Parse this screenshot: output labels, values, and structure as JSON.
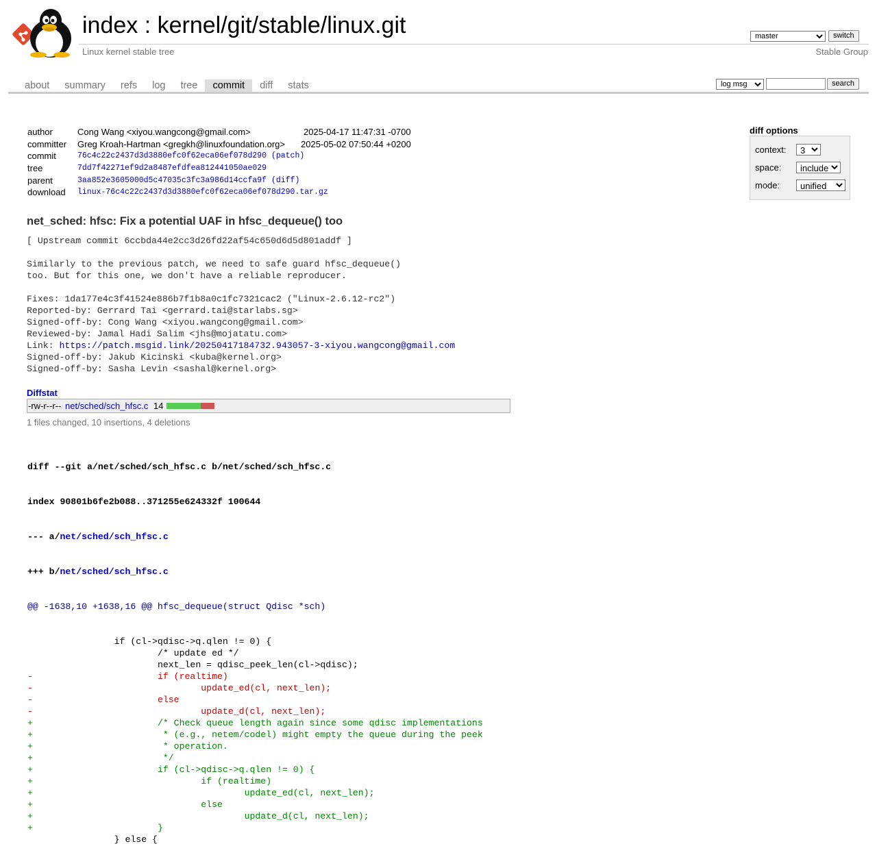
{
  "header": {
    "title_prefix": "index",
    "title_sep": " : ",
    "repo_path": "kernel/git/stable/linux.git",
    "subtitle": "Linux kernel stable tree",
    "owner": "Stable Group",
    "branch_selected": "master",
    "switch_label": "switch"
  },
  "tabs": [
    {
      "label": "about"
    },
    {
      "label": "summary"
    },
    {
      "label": "refs"
    },
    {
      "label": "log"
    },
    {
      "label": "tree"
    },
    {
      "label": "commit",
      "active": true
    },
    {
      "label": "diff"
    },
    {
      "label": "stats"
    }
  ],
  "search": {
    "type_selected": "log msg",
    "query": "",
    "button_label": "search"
  },
  "commit_info": {
    "author_label": "author",
    "author": "Cong Wang <xiyou.wangcong@gmail.com>",
    "author_date": "2025-04-17 11:47:31 -0700",
    "committer_label": "committer",
    "committer": "Greg Kroah-Hartman <gregkh@linuxfoundation.org>",
    "committer_date": "2025-05-02 07:50:44 +0200",
    "commit_label": "commit",
    "commit": "76c4c22c2437d3d3880efc0f62eca06ef078d290",
    "commit_link": "(patch)",
    "tree_label": "tree",
    "tree": "7dd7f42271ef9d2a8487efdfea812441050ae029",
    "parent_label": "parent",
    "parent": "3aa852e3605000d5c47035c3fc3a986d14ccfa9f",
    "parent_link": "(diff)",
    "download_label": "download",
    "download": "linux-76c4c22c2437d3d3880efc0f62eca06ef078d290.tar.gz"
  },
  "diff_options": {
    "title": "diff options",
    "context_label": "context:",
    "context_value": "3",
    "space_label": "space:",
    "space_value": "include",
    "mode_label": "mode:",
    "mode_value": "unified"
  },
  "message": {
    "subject": "net_sched: hfsc: Fix a potential UAF in hfsc_dequeue() too",
    "body_before_link": "[ Upstream commit 6ccbda44e2cc3d26fd22af54c650d6d5d801addf ]\n\nSimilarly to the previous patch, we need to safe guard hfsc_dequeue()\ntoo. But for this one, we don't have a reliable reproducer.\n\nFixes: 1da177e4c3f41524e886b7f1b8a0c1fc7321cac2 (\"Linux-2.6.12-rc2\")\nReported-by: Gerrard Tai <gerrard.tai@starlabs.sg>\nSigned-off-by: Cong Wang <xiyou.wangcong@gmail.com>\nReviewed-by: Jamal Hadi Salim <jhs@mojatatu.com>\n",
    "link_label": "Link: ",
    "link_url": "https://patch.msgid.link/20250417184732.943057-3-xiyou.wangcong@gmail.com",
    "body_after_link": "\nSigned-off-by: Jakub Kicinski <kuba@kernel.org>\nSigned-off-by: Sasha Levin <sashal@kernel.org>"
  },
  "diffstat": {
    "header": "Diffstat",
    "mode": "-rw-r--r--",
    "file": "net/sched/sch_hfsc.c",
    "changes": "14",
    "insertions": 10,
    "deletions": 4,
    "summary": "1 files changed, 10 insertions, 4 deletions",
    "add_color": "#55cc55",
    "del_color": "#cc5555"
  },
  "diff": {
    "line1_prefix": "diff --git a/net/sched/sch_hfsc.c b/net/sched/sch_hfsc.c",
    "line2": "index 90801b6fe2b088..371255e624332f 100644",
    "old_prefix": "--- a/",
    "new_prefix": "+++ b/",
    "file": "net/sched/sch_hfsc.c",
    "hunk": "@@ -1638,10 +1638,16 @@ hfsc_dequeue(struct Qdisc *sch)",
    "lines": [
      {
        "type": "ctx",
        "text": " \t\tif (cl->qdisc->q.qlen != 0) {"
      },
      {
        "type": "ctx",
        "text": " \t\t\t/* update ed */"
      },
      {
        "type": "ctx",
        "text": " \t\t\tnext_len = qdisc_peek_len(cl->qdisc);"
      },
      {
        "type": "del",
        "text": "-\t\t\tif (realtime)"
      },
      {
        "type": "del",
        "text": "-\t\t\t\tupdate_ed(cl, next_len);"
      },
      {
        "type": "del",
        "text": "-\t\t\telse"
      },
      {
        "type": "del",
        "text": "-\t\t\t\tupdate_d(cl, next_len);"
      },
      {
        "type": "add",
        "text": "+\t\t\t/* Check queue length again since some qdisc implementations"
      },
      {
        "type": "add",
        "text": "+\t\t\t * (e.g., netem/codel) might empty the queue during the peek"
      },
      {
        "type": "add",
        "text": "+\t\t\t * operation."
      },
      {
        "type": "add",
        "text": "+\t\t\t */"
      },
      {
        "type": "add",
        "text": "+\t\t\tif (cl->qdisc->q.qlen != 0) {"
      },
      {
        "type": "add",
        "text": "+\t\t\t\tif (realtime)"
      },
      {
        "type": "add",
        "text": "+\t\t\t\t\tupdate_ed(cl, next_len);"
      },
      {
        "type": "add",
        "text": "+\t\t\t\telse"
      },
      {
        "type": "add",
        "text": "+\t\t\t\t\tupdate_d(cl, next_len);"
      },
      {
        "type": "add",
        "text": "+\t\t\t}"
      },
      {
        "type": "ctx",
        "text": " \t\t} else {"
      }
    ]
  }
}
